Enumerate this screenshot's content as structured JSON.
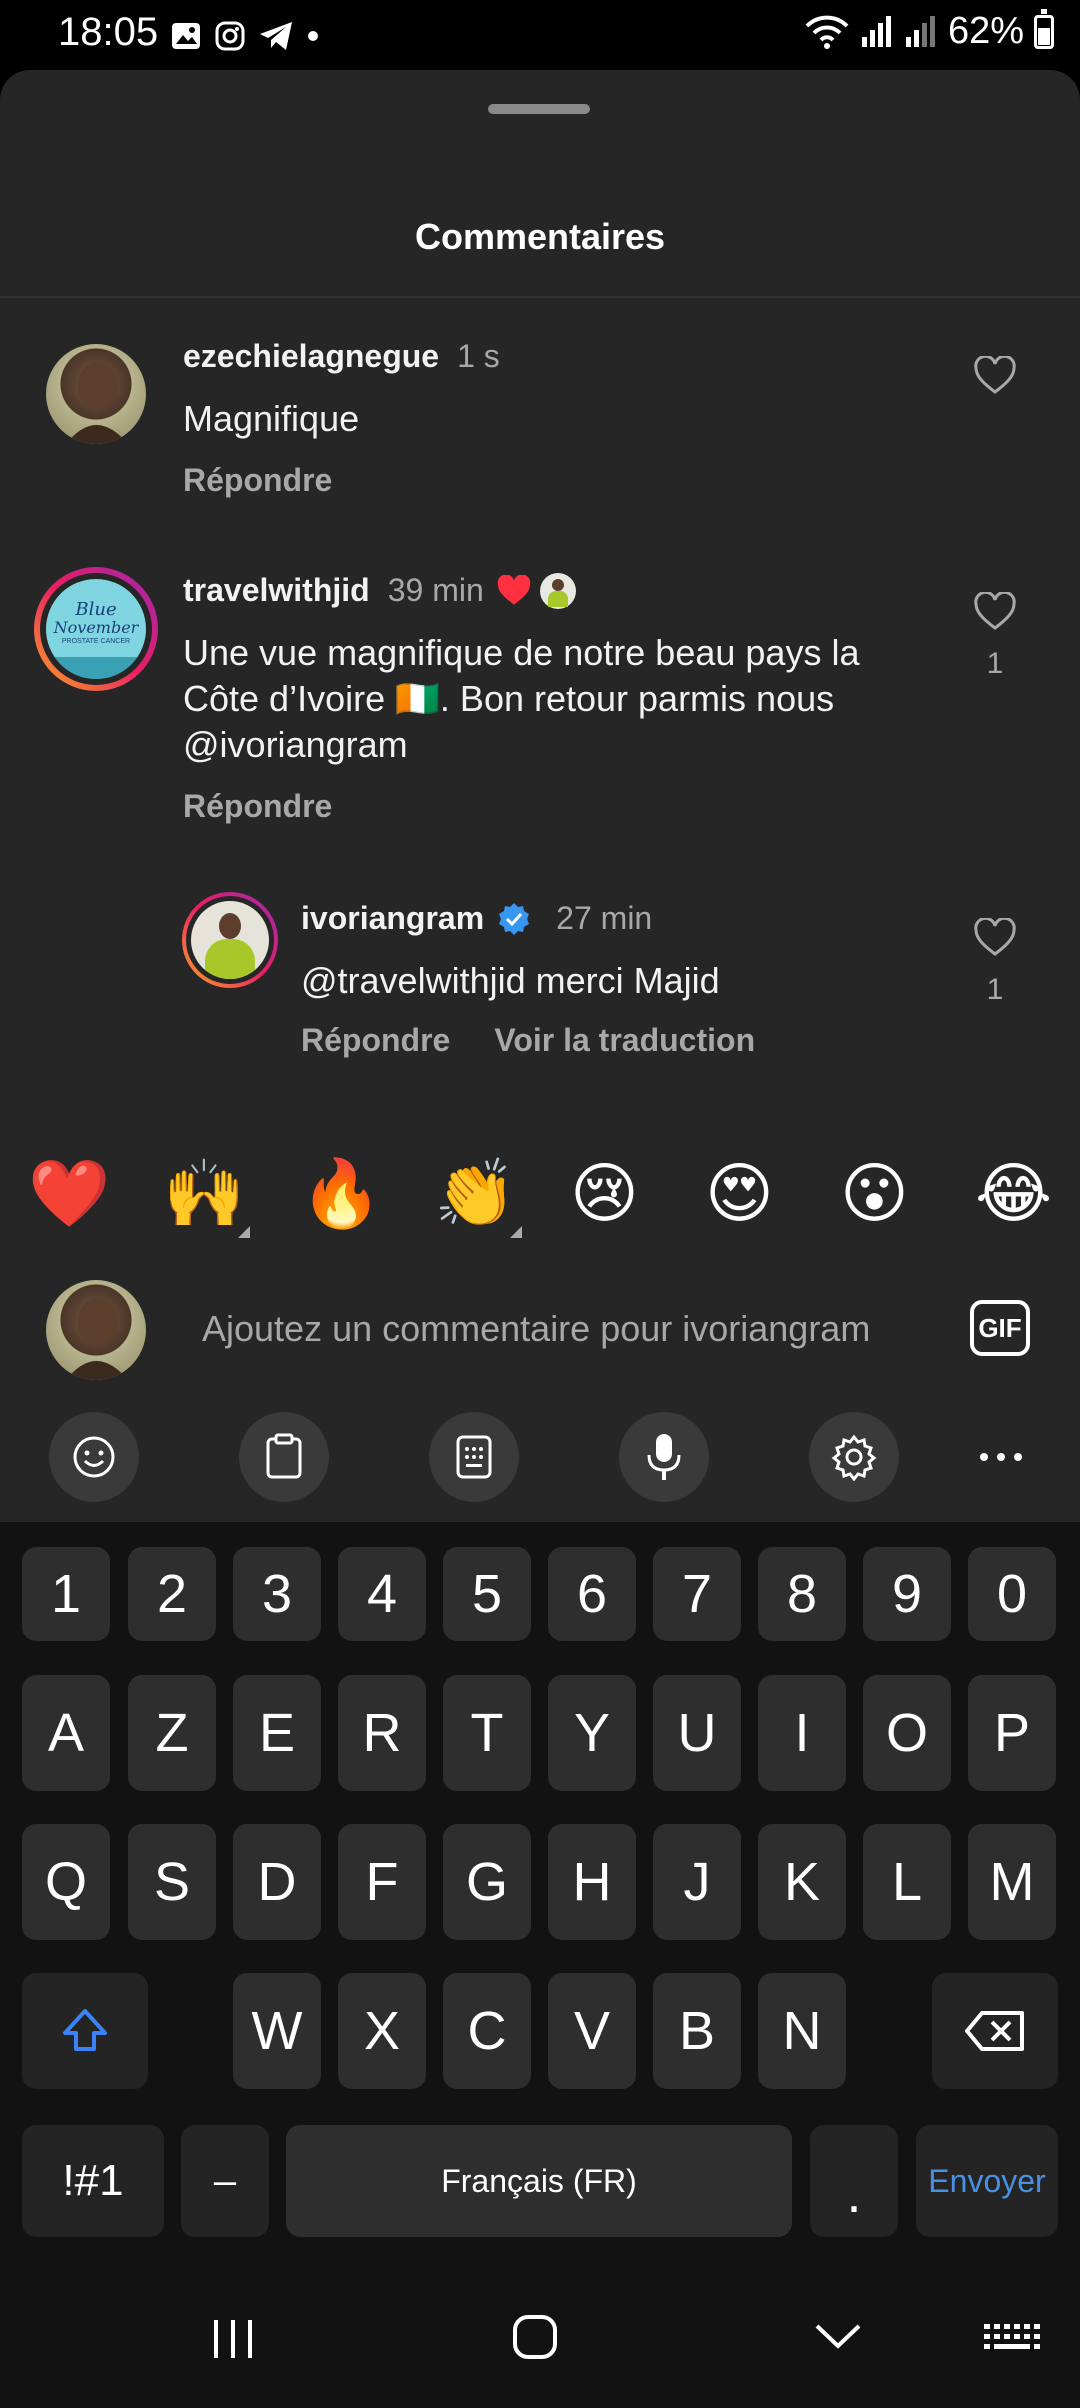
{
  "status": {
    "time": "18:05",
    "battery": "62%"
  },
  "sheet": {
    "title": "Commentaires"
  },
  "comments": [
    {
      "user": "ezechielagnegue",
      "time": "1 s",
      "text": "Magnifique",
      "reply": "Répondre",
      "likes": ""
    },
    {
      "user": "travelwithjid",
      "time": "39 min",
      "text_lines": [
        "Une vue magnifique de notre beau pays la",
        "Côte d’Ivoire 🇨🇮. Bon retour parmis nous",
        "@ivoriangram"
      ],
      "reply": "Répondre",
      "likes": "1"
    },
    {
      "user": "ivoriangram",
      "time": "27 min",
      "text": "@travelwithjid merci Majid",
      "reply": "Répondre",
      "translate": "Voir la traduction",
      "likes": "1"
    }
  ],
  "avatar_text": {
    "blue": "Blue",
    "november": "November",
    "sub": "PROSTATE CANCER"
  },
  "emojis": [
    "❤️",
    "🙌",
    "🔥",
    "👏",
    "😢",
    "😍",
    "😮",
    "😂"
  ],
  "input": {
    "placeholder": "Ajoutez un commentaire pour ivoriangram",
    "gif": "GIF"
  },
  "keyboard": {
    "row_numbers": [
      "1",
      "2",
      "3",
      "4",
      "5",
      "6",
      "7",
      "8",
      "9",
      "0"
    ],
    "row1": [
      "A",
      "Z",
      "E",
      "R",
      "T",
      "Y",
      "U",
      "I",
      "O",
      "P"
    ],
    "row2": [
      "Q",
      "S",
      "D",
      "F",
      "G",
      "H",
      "J",
      "K",
      "L",
      "M"
    ],
    "row3": [
      "W",
      "X",
      "C",
      "V",
      "B",
      "N"
    ],
    "symbols": "!#1",
    "dash": "–",
    "space": "Français (FR)",
    "period": ".",
    "send": "Envoyer"
  },
  "colors": {
    "send": "#4a90e2",
    "shift": "#3b82f6",
    "verified": "#3797f0",
    "heart": "#ff3040"
  }
}
